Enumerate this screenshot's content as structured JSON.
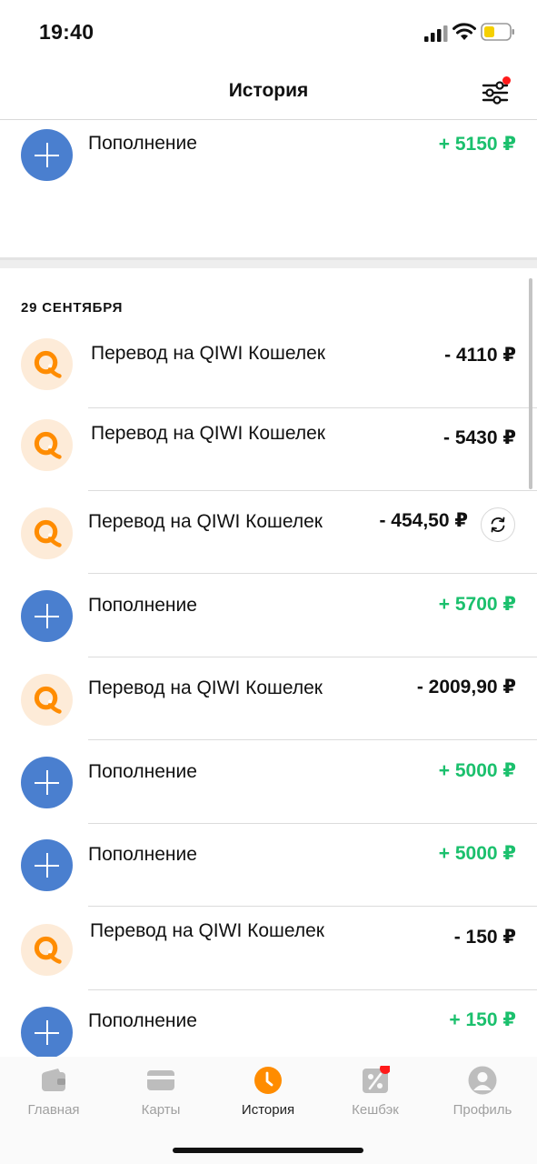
{
  "status_bar": {
    "time": "19:40"
  },
  "header": {
    "title": "История",
    "filter_icon": "filter-sliders-icon"
  },
  "colors": {
    "income": "#1bc06d",
    "topup_avatar": "#4a7fcf",
    "qiwi_orange": "#ff8c00",
    "qiwi_bg": "#fdebd8",
    "active_tab": "#ff8c00",
    "badge": "#ff1a1a"
  },
  "earlier": {
    "items": [
      {
        "type": "topup",
        "title": "Пополнение",
        "amount": "+ 5150 ₽"
      }
    ]
  },
  "group": {
    "date": "29 СЕНТЯБРЯ",
    "items": [
      {
        "type": "qiwi",
        "title": "Перевод на QIWI Кошелек",
        "amount": "- 4110 ₽"
      },
      {
        "type": "qiwi",
        "title": "Перевод на QIWI Кошелек",
        "amount": "- 5430 ₽"
      },
      {
        "type": "qiwi",
        "title": "Перевод на QIWI Кошелек",
        "amount": "- 454,50 ₽",
        "action_icon": "repeat-icon"
      },
      {
        "type": "topup",
        "title": "Пополнение",
        "amount": "+ 5700 ₽"
      },
      {
        "type": "qiwi",
        "title": "Перевод на QIWI Кошелек",
        "amount": "- 2009,90 ₽"
      },
      {
        "type": "topup",
        "title": "Пополнение",
        "amount": "+ 5000 ₽"
      },
      {
        "type": "topup",
        "title": "Пополнение",
        "amount": "+ 5000 ₽"
      },
      {
        "type": "qiwi",
        "title": "Перевод на QIWI Кошелек",
        "amount": "- 150 ₽"
      },
      {
        "type": "topup",
        "title": "Пополнение",
        "amount": "+ 150 ₽"
      }
    ]
  },
  "tab_bar": {
    "tabs": [
      {
        "label": "Главная",
        "icon": "wallet-icon"
      },
      {
        "label": "Карты",
        "icon": "card-icon"
      },
      {
        "label": "История",
        "icon": "clock-icon",
        "active": true
      },
      {
        "label": "Кешбэк",
        "icon": "percent-tag-icon",
        "badge": true
      },
      {
        "label": "Профиль",
        "icon": "profile-icon"
      }
    ]
  }
}
